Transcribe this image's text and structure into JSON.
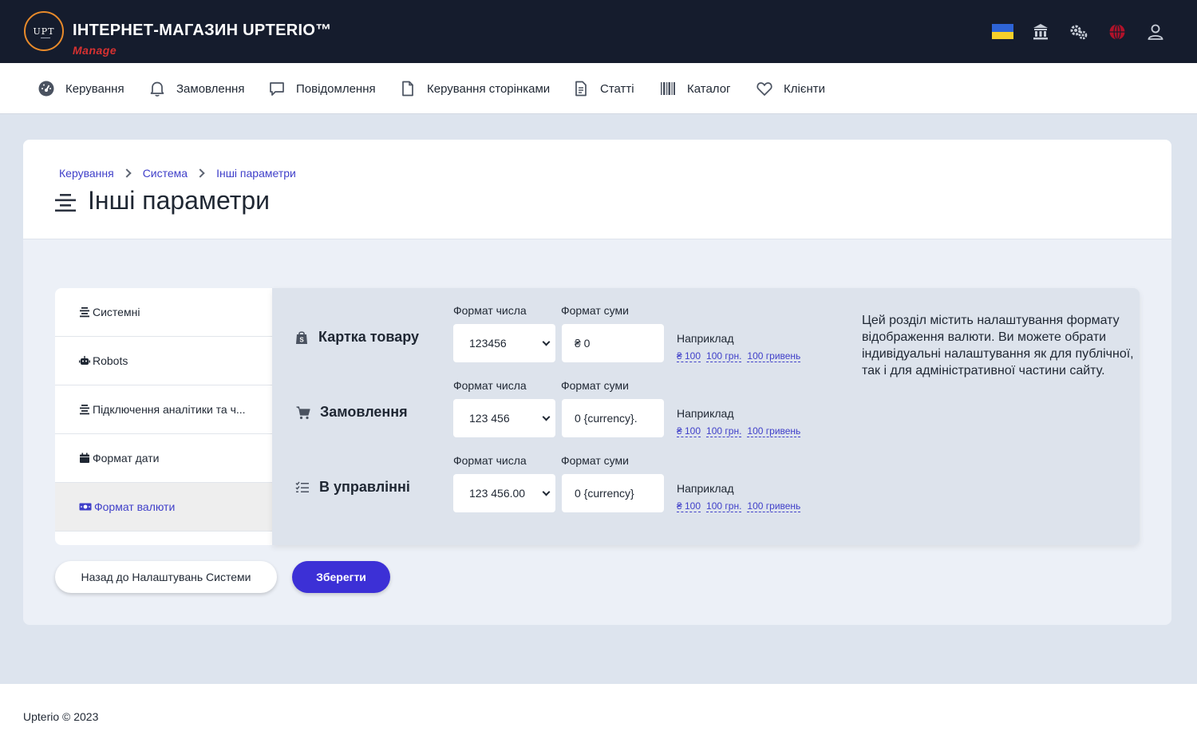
{
  "header": {
    "logo_text": "UPT",
    "title": "ІНТЕРНЕТ-МАГАЗИН UPTERIO™",
    "subtitle": "Manage",
    "icons": [
      "ukraine-flag",
      "bank-icon",
      "gears-icon",
      "globe-icon",
      "user-icon"
    ]
  },
  "nav": {
    "items": [
      {
        "label": "Керування",
        "icon": "dashboard-icon"
      },
      {
        "label": "Замовлення",
        "icon": "bell-icon"
      },
      {
        "label": "Повідомлення",
        "icon": "chat-icon"
      },
      {
        "label": "Керування сторінками",
        "icon": "file-icon"
      },
      {
        "label": "Статті",
        "icon": "document-icon"
      },
      {
        "label": "Каталог",
        "icon": "barcode-icon"
      },
      {
        "label": "Клієнти",
        "icon": "heart-icon"
      }
    ]
  },
  "breadcrumb": [
    "Керування",
    "Система",
    "Інші параметри"
  ],
  "page_title": "Інші параметри",
  "tabs": [
    {
      "label": "Системні",
      "icon": "list-icon"
    },
    {
      "label": "Robots",
      "icon": "robot-icon"
    },
    {
      "label": "Підключення аналітики та ч...",
      "icon": "list-icon"
    },
    {
      "label": "Формат дати",
      "icon": "calendar-icon"
    },
    {
      "label": "Формат валюти",
      "icon": "money-icon",
      "active": true
    }
  ],
  "sections": [
    {
      "label": "Картка товару",
      "icon": "shopping-bag-icon",
      "number_format_label": "Формат числа",
      "number_format_value": "123456",
      "sum_format_label": "Формат суми",
      "sum_format_value": "₴ 0",
      "example_label": "Наприклад",
      "examples": [
        "₴ 100",
        "100 грн.",
        "100 гривень"
      ]
    },
    {
      "label": "Замовлення",
      "icon": "cart-icon",
      "number_format_label": "Формат числа",
      "number_format_value": "123 456",
      "sum_format_label": "Формат суми",
      "sum_format_value": "0 {currency}.",
      "example_label": "Наприклад",
      "examples": [
        "₴ 100",
        "100 грн.",
        "100 гривень"
      ]
    },
    {
      "label": "В управлінні",
      "icon": "checklist-icon",
      "number_format_label": "Формат числа",
      "number_format_value": "123 456.00",
      "sum_format_label": "Формат суми",
      "sum_format_value": "0 {currency}",
      "example_label": "Наприклад",
      "examples": [
        "₴ 100",
        "100 грн.",
        "100 гривень"
      ]
    }
  ],
  "description": "Цей розділ містить налаштування формату відображення валюти. Ви можете обрати індивідуальні налаштування як для публічної, так і для адміністративної частини сайту.",
  "buttons": {
    "back": "Назад до Налаштувань Системи",
    "save": "Зберегти"
  },
  "footer": "Upterio © 2023",
  "colors": {
    "header_bg": "#151c2d",
    "accent": "#3c30d6",
    "link": "#3f3fc9",
    "brand_red": "#d63131"
  }
}
